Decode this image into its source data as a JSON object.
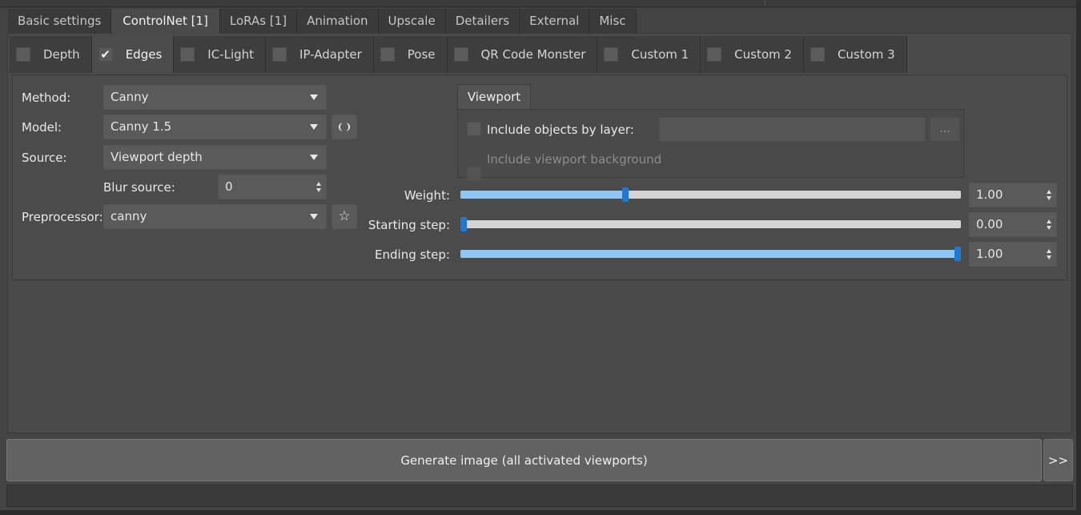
{
  "main_tabs": [
    {
      "label": "Basic settings",
      "active": false
    },
    {
      "label": "ControlNet [1]",
      "active": true
    },
    {
      "label": "LoRAs [1]",
      "active": false
    },
    {
      "label": "Animation",
      "active": false
    },
    {
      "label": "Upscale",
      "active": false
    },
    {
      "label": "Detailers",
      "active": false
    },
    {
      "label": "External",
      "active": false
    },
    {
      "label": "Misc",
      "active": false
    }
  ],
  "sub_tabs": [
    {
      "label": "Depth",
      "checked": false,
      "active": false
    },
    {
      "label": "Edges",
      "checked": true,
      "active": true
    },
    {
      "label": "IC-Light",
      "checked": false,
      "active": false
    },
    {
      "label": "IP-Adapter",
      "checked": false,
      "active": false
    },
    {
      "label": "Pose",
      "checked": false,
      "active": false
    },
    {
      "label": "QR Code Monster",
      "checked": false,
      "active": false
    },
    {
      "label": "Custom 1",
      "checked": false,
      "active": false
    },
    {
      "label": "Custom 2",
      "checked": false,
      "active": false
    },
    {
      "label": "Custom 3",
      "checked": false,
      "active": false
    }
  ],
  "checkmark": "✔",
  "form": {
    "method": {
      "label": "Method:",
      "value": "Canny"
    },
    "model": {
      "label": "Model:",
      "value": "Canny 1.5",
      "refresh_icon": "refresh-icon"
    },
    "source": {
      "label": "Source:",
      "value": "Viewport depth"
    },
    "blur_source": {
      "label": "Blur source:",
      "value": "0"
    },
    "preprocessor": {
      "label": "Preprocessor:",
      "value": "canny",
      "star_icon": "star-icon"
    }
  },
  "icons": {
    "refresh": "❨❩",
    "star": "☆"
  },
  "viewport": {
    "tab_label": "Viewport",
    "include_objects_label": "Include objects by layer:",
    "include_objects_checked": false,
    "layer_value": "",
    "browse_label": "...",
    "include_background_label": "Include viewport background",
    "include_background_checked": false,
    "include_background_enabled": false
  },
  "sliders": {
    "weight": {
      "label": "Weight:",
      "value": "1.00",
      "fraction": 0.33
    },
    "starting_step": {
      "label": "Starting step:",
      "value": "0.00",
      "fraction": 0.0
    },
    "ending_step": {
      "label": "Ending step:",
      "value": "1.00",
      "fraction": 1.0
    }
  },
  "colors": {
    "accent": "#1f78d1",
    "slider_fill": "#8dc6f3",
    "slider_track": "#d4d4d4"
  },
  "generate_label": "Generate image (all activated viewports)",
  "more_label": ">>"
}
